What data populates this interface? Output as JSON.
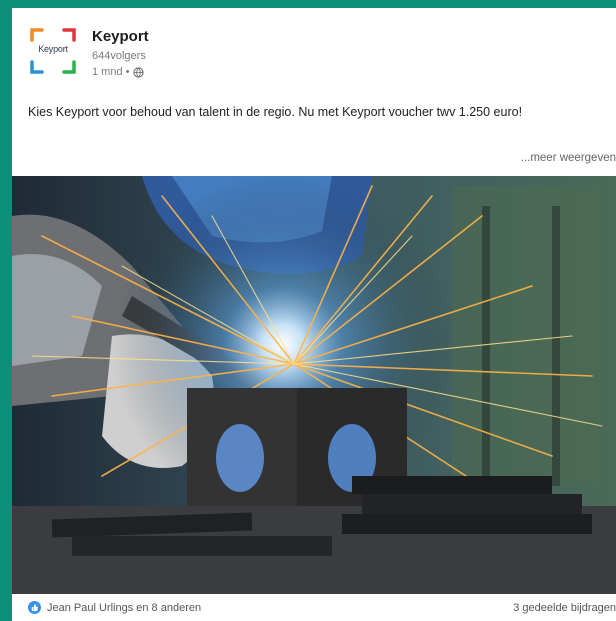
{
  "post": {
    "company_name": "Keyport",
    "logo_text": "Keyport",
    "followers": "644volgers",
    "time": "1 mnd •",
    "text": "Kies Keyport voor behoud van talent in de regio. Nu met Keyport voucher twv 1.250 euro!",
    "see_more": "...meer weergeven",
    "reactions_text": "Jean Paul Urlings en 8 anderen",
    "shares_text": "3 gedeelde bijdragen"
  },
  "colors": {
    "accent_border": "#0e8f7a",
    "like_blue": "#378fe9",
    "logo_orange": "#f08a24",
    "logo_red": "#e2333b",
    "logo_green": "#27b24a",
    "logo_blue": "#2a8fd6"
  },
  "icons": {
    "logo": "keyport-logo",
    "globe": "globe-icon",
    "like": "like-icon"
  }
}
